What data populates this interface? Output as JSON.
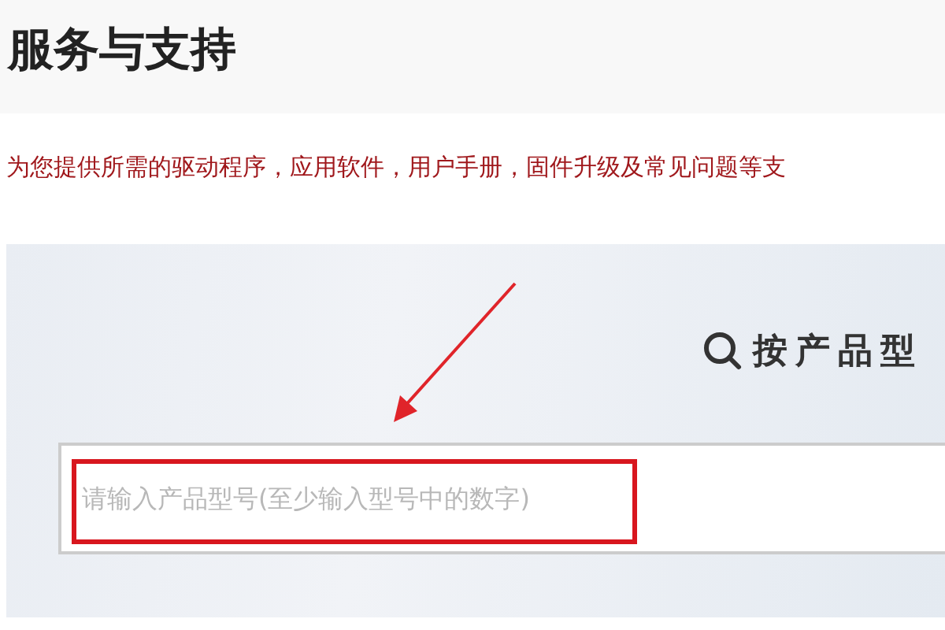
{
  "page_title": "服务与支持",
  "subtitle": "为您提供所需的驱动程序，应用软件，用户手册，固件升级及常见问题等支",
  "search_panel": {
    "heading": "按产品型",
    "placeholder": "请输入产品型号(至少输入型号中的数字)"
  }
}
